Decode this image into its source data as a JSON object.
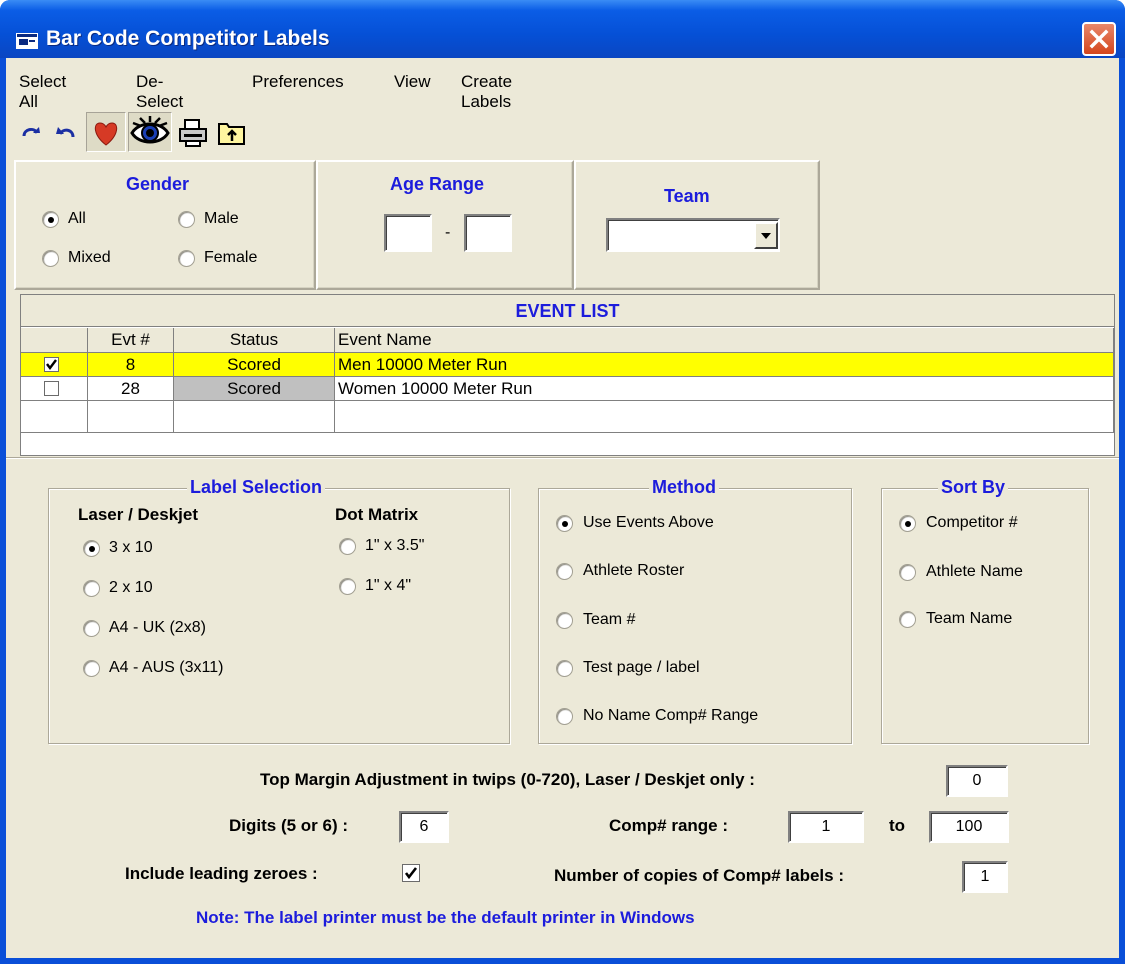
{
  "window": {
    "title": "Bar Code Competitor Labels"
  },
  "menu": [
    "Select All",
    "De-Select",
    "Preferences",
    "View",
    "Create Labels"
  ],
  "toolbar": {
    "icons": [
      "redo-icon",
      "undo-icon",
      "heart-icon",
      "eye-icon",
      "printer-icon",
      "folder-up-icon"
    ]
  },
  "gender": {
    "title": "Gender",
    "options": [
      "All",
      "Male",
      "Mixed",
      "Female"
    ],
    "selected": "All"
  },
  "age_range": {
    "title": "Age Range",
    "from": "",
    "separator": "-",
    "to": ""
  },
  "team": {
    "title": "Team",
    "value": ""
  },
  "event_list": {
    "title": "EVENT LIST",
    "columns": [
      "",
      "Evt #",
      "Status",
      "Event Name"
    ],
    "rows": [
      {
        "checked": true,
        "evt": "8",
        "status": "Scored",
        "name": "Men 10000 Meter Run",
        "highlight": "#ffff00"
      },
      {
        "checked": false,
        "evt": "28",
        "status": "Scored",
        "name": "Women 10000 Meter Run",
        "highlight": ""
      }
    ]
  },
  "label_selection": {
    "title": "Label Selection",
    "laser_header": "Laser / Deskjet",
    "dot_header": "Dot Matrix",
    "laser_options": [
      "3 x 10",
      "2 x 10",
      "A4 - UK (2x8)",
      "A4 - AUS (3x11)"
    ],
    "dot_options": [
      "1\" x 3.5\"",
      "1\" x 4\""
    ],
    "selected": "3 x 10"
  },
  "method": {
    "title": "Method",
    "options": [
      "Use Events Above",
      "Athlete Roster",
      "Team #",
      "Test page / label",
      "No Name Comp# Range"
    ],
    "selected": "Use Events Above"
  },
  "sort_by": {
    "title": "Sort By",
    "options": [
      "Competitor #",
      "Athlete Name",
      "Team Name"
    ],
    "selected": "Competitor #"
  },
  "settings": {
    "top_margin_label": "Top Margin Adjustment in twips (0-720), Laser / Deskjet only :",
    "top_margin_value": "0",
    "digits_label": "Digits (5 or 6) :",
    "digits_value": "6",
    "comp_range_label": "Comp# range :",
    "comp_range_from": "1",
    "comp_range_to_label": "to",
    "comp_range_to": "100",
    "leading_zeroes_label": "Include leading zeroes :",
    "leading_zeroes_checked": true,
    "copies_label": "Number of copies of Comp# labels :",
    "copies_value": "1",
    "note": "Note:  The label printer must be the default printer in Windows"
  }
}
